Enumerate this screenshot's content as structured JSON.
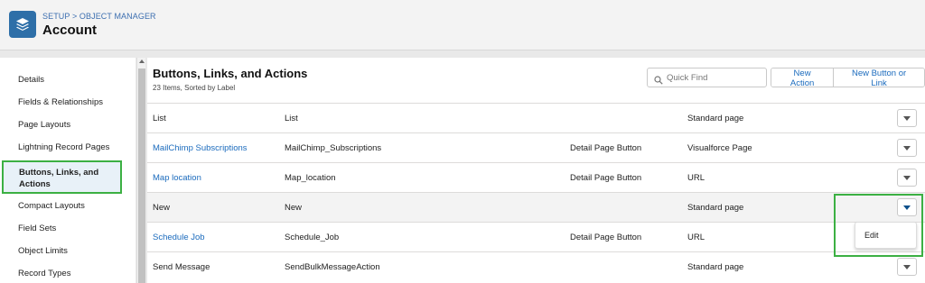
{
  "header": {
    "breadcrumb": "SETUP > OBJECT MANAGER",
    "title": "Account"
  },
  "sidebar": {
    "items": [
      {
        "label": "Details"
      },
      {
        "label": "Fields & Relationships"
      },
      {
        "label": "Page Layouts"
      },
      {
        "label": "Lightning Record Pages"
      },
      {
        "label": "Buttons, Links, and Actions",
        "active": true
      },
      {
        "label": "Compact Layouts"
      },
      {
        "label": "Field Sets"
      },
      {
        "label": "Object Limits"
      },
      {
        "label": "Record Types"
      }
    ]
  },
  "main": {
    "title": "Buttons, Links, and Actions",
    "subtitle": "23 Items, Sorted by Label",
    "search": {
      "placeholder": "Quick Find",
      "value": ""
    },
    "buttons": {
      "new_action": "New Action",
      "new_button_or_link": "New Button or Link"
    },
    "rows": [
      {
        "label": "List",
        "name": "List",
        "display_type": "",
        "content_source": "Standard page"
      },
      {
        "label": "MailChimp Subscriptions",
        "name": "MailChimp_Subscriptions",
        "display_type": "Detail Page Button",
        "content_source": "Visualforce Page"
      },
      {
        "label": "Map location",
        "name": "Map_location",
        "display_type": "Detail Page Button",
        "content_source": "URL"
      },
      {
        "label": "New",
        "name": "New",
        "display_type": "",
        "content_source": "Standard page"
      },
      {
        "label": "Schedule Job",
        "name": "Schedule_Job",
        "display_type": "Detail Page Button",
        "content_source": "URL"
      },
      {
        "label": "Send Message",
        "name": "SendBulkMessageAction",
        "display_type": "",
        "content_source": "Standard page"
      }
    ],
    "row_menu": {
      "edit": "Edit"
    }
  },
  "colors": {
    "brand_blue": "#2e6fa8",
    "link_blue": "#1b6bbd",
    "highlight_green": "#3cb043",
    "active_bg": "#e8f1f8"
  }
}
